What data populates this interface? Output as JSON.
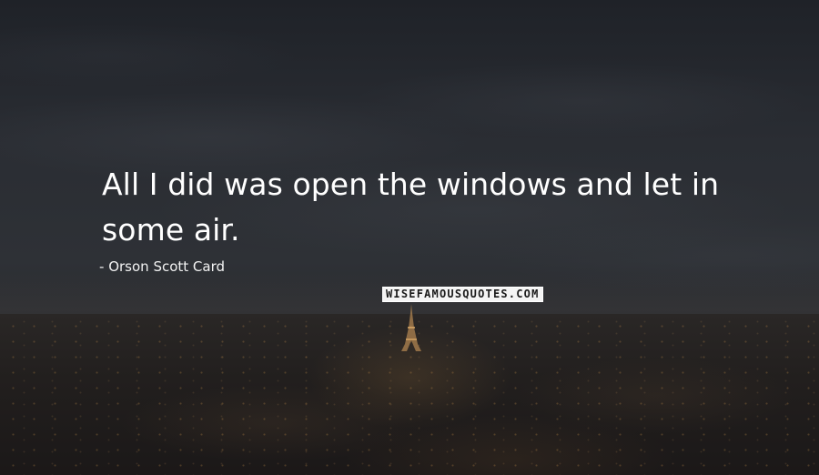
{
  "quote": {
    "line1": "All I did was open the windows and let in",
    "line2": "some air."
  },
  "author": {
    "prefix": "-",
    "name": "Orson Scott Card"
  },
  "watermark": {
    "text": "WISEFAMOUSQUOTES.COM"
  },
  "background": {
    "scene": "night city skyline under cloudy sky",
    "landmark_icon": "eiffel-tower-icon",
    "sky_color": "#2b2e34",
    "city_color": "#221f1e",
    "light_color": "#c8904a"
  }
}
